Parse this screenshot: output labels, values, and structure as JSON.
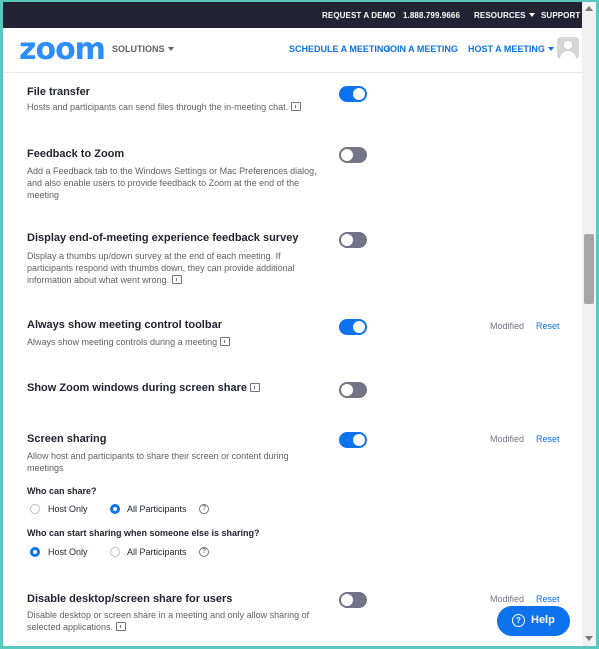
{
  "topbar": {
    "request_demo": "REQUEST A DEMO",
    "phone": "1.888.799.9666",
    "resources": "RESOURCES",
    "support": "SUPPORT",
    "background": "#232333"
  },
  "nav": {
    "logo": "zoom",
    "solutions": "SOLUTIONS",
    "schedule": "SCHEDULE A MEETING",
    "join": "JOIN A MEETING",
    "host": "HOST A MEETING"
  },
  "colors": {
    "accent": "#0e72ed",
    "toggle_off": "#747487",
    "brand": "#2d8cff"
  },
  "settings": {
    "file_transfer": {
      "title": "File transfer",
      "desc": "Hosts and participants can send files through the in-meeting chat.",
      "enabled": true
    },
    "feedback": {
      "title": "Feedback to Zoom",
      "desc": "Add a Feedback tab to the Windows Settings or Mac Preferences dialog, and also enable users to provide feedback to Zoom at the end of the meeting",
      "enabled": false
    },
    "end_survey": {
      "title": "Display end-of-meeting experience feedback survey",
      "desc": "Display a thumbs up/down survey at the end of each meeting. If participants respond with thumbs down, they can provide additional information about what went wrong.",
      "enabled": false
    },
    "toolbar": {
      "title": "Always show meeting control toolbar",
      "desc": "Always show meeting controls during a meeting",
      "enabled": true,
      "modified": "Modified",
      "reset": "Reset"
    },
    "zoom_windows": {
      "title": "Show Zoom windows during screen share",
      "enabled": false
    },
    "screen_sharing": {
      "title": "Screen sharing",
      "desc": "Allow host and participants to share their screen or content during meetings",
      "enabled": true,
      "modified": "Modified",
      "reset": "Reset",
      "q1": "Who can share?",
      "q1_opt1": "Host Only",
      "q1_opt2": "All Participants",
      "q1_selected": "All Participants",
      "q2": "Who can start sharing when someone else is sharing?",
      "q2_opt1": "Host Only",
      "q2_opt2": "All Participants",
      "q2_selected": "Host Only"
    },
    "disable_share": {
      "title": "Disable desktop/screen share for users",
      "desc": "Disable desktop or screen share in a meeting and only allow sharing of selected applications.",
      "enabled": false,
      "modified": "Modified",
      "reset": "Reset"
    }
  },
  "help": {
    "label": "Help"
  }
}
